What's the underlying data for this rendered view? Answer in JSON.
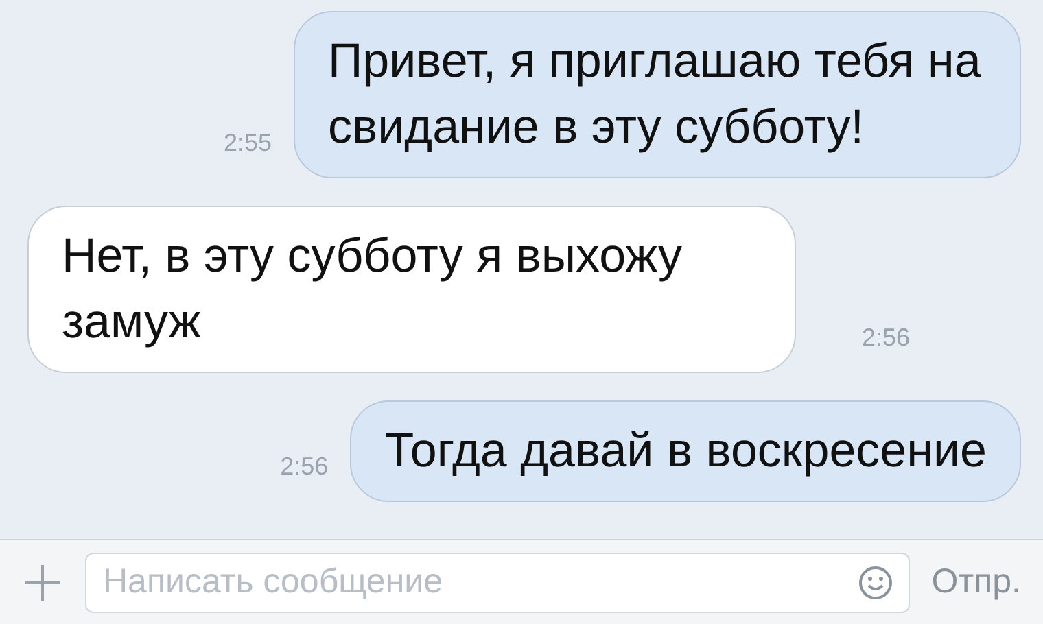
{
  "messages": [
    {
      "kind": "outgoing",
      "text": "Привет, я приглашаю тебя на свидание в эту субботу!",
      "time": "2:55"
    },
    {
      "kind": "incoming",
      "text": "Нет, в эту субботу я выхожу замуж",
      "time": "2:56"
    },
    {
      "kind": "outgoing",
      "text": "Тогда давай в воскресение",
      "time": "2:56"
    }
  ],
  "composer": {
    "placeholder": "Написать сообщение",
    "send": "Отпр."
  }
}
